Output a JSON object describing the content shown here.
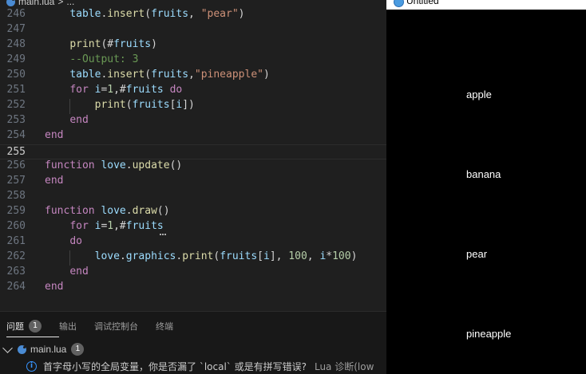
{
  "breadcrumb": {
    "file": "main.lua",
    "separator": ">",
    "rest": "..."
  },
  "code_lines": [
    {
      "num": "246",
      "indent": 1,
      "tokens": [
        [
          "var",
          "table"
        ],
        [
          "plain",
          "."
        ],
        [
          "fn",
          "insert"
        ],
        [
          "plain",
          "("
        ],
        [
          "var",
          "fruits"
        ],
        [
          "plain",
          ", "
        ],
        [
          "str",
          "\"pear\""
        ],
        [
          "plain",
          ")"
        ]
      ]
    },
    {
      "num": "247",
      "indent": 0,
      "tokens": []
    },
    {
      "num": "248",
      "indent": 1,
      "tokens": [
        [
          "fn",
          "print"
        ],
        [
          "plain",
          "(#"
        ],
        [
          "var",
          "fruits"
        ],
        [
          "plain",
          ")"
        ]
      ]
    },
    {
      "num": "249",
      "indent": 1,
      "tokens": [
        [
          "cm",
          "--Output: 3"
        ]
      ]
    },
    {
      "num": "250",
      "indent": 1,
      "tokens": [
        [
          "var",
          "table"
        ],
        [
          "plain",
          "."
        ],
        [
          "fn",
          "insert"
        ],
        [
          "plain",
          "("
        ],
        [
          "var",
          "fruits"
        ],
        [
          "plain",
          ","
        ],
        [
          "str",
          "\"pineapple\""
        ],
        [
          "plain",
          ")"
        ]
      ]
    },
    {
      "num": "251",
      "indent": 1,
      "tokens": [
        [
          "kw",
          "for"
        ],
        [
          "plain",
          " "
        ],
        [
          "var",
          "i"
        ],
        [
          "plain",
          "="
        ],
        [
          "num",
          "1"
        ],
        [
          "plain",
          ",#"
        ],
        [
          "var",
          "fruits"
        ],
        [
          "plain",
          " "
        ],
        [
          "kw",
          "do"
        ]
      ]
    },
    {
      "num": "252",
      "indent": 2,
      "tokens": [
        [
          "fn",
          "print"
        ],
        [
          "plain",
          "("
        ],
        [
          "var",
          "fruits"
        ],
        [
          "plain",
          "["
        ],
        [
          "var",
          "i"
        ],
        [
          "plain",
          "])"
        ]
      ]
    },
    {
      "num": "253",
      "indent": 1,
      "tokens": [
        [
          "kw",
          "end"
        ]
      ]
    },
    {
      "num": "254",
      "indent": 0,
      "tokens": [
        [
          "kw",
          "end"
        ]
      ]
    },
    {
      "num": "255",
      "indent": 0,
      "tokens": [],
      "current": true
    },
    {
      "num": "256",
      "indent": 0,
      "tokens": [
        [
          "kw",
          "function"
        ],
        [
          "plain",
          " "
        ],
        [
          "var",
          "love"
        ],
        [
          "plain",
          "."
        ],
        [
          "fn",
          "update"
        ],
        [
          "plain",
          "()"
        ]
      ]
    },
    {
      "num": "257",
      "indent": 0,
      "tokens": [
        [
          "kw",
          "end"
        ]
      ]
    },
    {
      "num": "258",
      "indent": 0,
      "tokens": []
    },
    {
      "num": "259",
      "indent": 0,
      "tokens": [
        [
          "kw",
          "function"
        ],
        [
          "plain",
          " "
        ],
        [
          "var",
          "love"
        ],
        [
          "plain",
          "."
        ],
        [
          "fn",
          "draw"
        ],
        [
          "plain",
          "()"
        ]
      ]
    },
    {
      "num": "260",
      "indent": 1,
      "tokens": [
        [
          "kw",
          "for"
        ],
        [
          "plain",
          " "
        ],
        [
          "var",
          "i"
        ],
        [
          "plain",
          "="
        ],
        [
          "num",
          "1"
        ],
        [
          "plain",
          ",#"
        ],
        [
          "var",
          "fruits"
        ]
      ]
    },
    {
      "num": "261",
      "indent": 1,
      "tokens": [
        [
          "kw",
          "do"
        ]
      ]
    },
    {
      "num": "262",
      "indent": 2,
      "tokens": [
        [
          "var",
          "love"
        ],
        [
          "plain",
          "."
        ],
        [
          "var",
          "graphics"
        ],
        [
          "plain",
          "."
        ],
        [
          "fn",
          "print"
        ],
        [
          "plain",
          "("
        ],
        [
          "var",
          "fruits"
        ],
        [
          "plain",
          "["
        ],
        [
          "var",
          "i"
        ],
        [
          "plain",
          "], "
        ],
        [
          "num",
          "100"
        ],
        [
          "plain",
          ", "
        ],
        [
          "var",
          "i"
        ],
        [
          "plain",
          "*"
        ],
        [
          "num",
          "100"
        ],
        [
          "plain",
          ")"
        ]
      ]
    },
    {
      "num": "263",
      "indent": 1,
      "tokens": [
        [
          "kw",
          "end"
        ]
      ]
    },
    {
      "num": "264",
      "indent": 0,
      "tokens": [
        [
          "kw",
          "end"
        ]
      ]
    }
  ],
  "panel": {
    "tabs": [
      {
        "label": "问题",
        "badge": "1",
        "active": true
      },
      {
        "label": "输出"
      },
      {
        "label": "调试控制台"
      },
      {
        "label": "终端"
      }
    ],
    "file": {
      "name": "main.lua",
      "count": "1"
    },
    "message": {
      "text": "首字母小写的全局变量，你是否漏了 `local` 或是有拼写错误?",
      "source": "Lua 诊断(low"
    }
  },
  "game": {
    "title": "Untitled",
    "fruits": [
      "apple",
      "banana",
      "pear",
      "pineapple"
    ]
  },
  "colors": {
    "keyword": "#c586c0",
    "function": "#dcdcaa",
    "variable": "#9cdcfe",
    "string": "#ce9178",
    "number": "#b5cea8",
    "comment": "#6a9955",
    "info": "#3794ff"
  }
}
